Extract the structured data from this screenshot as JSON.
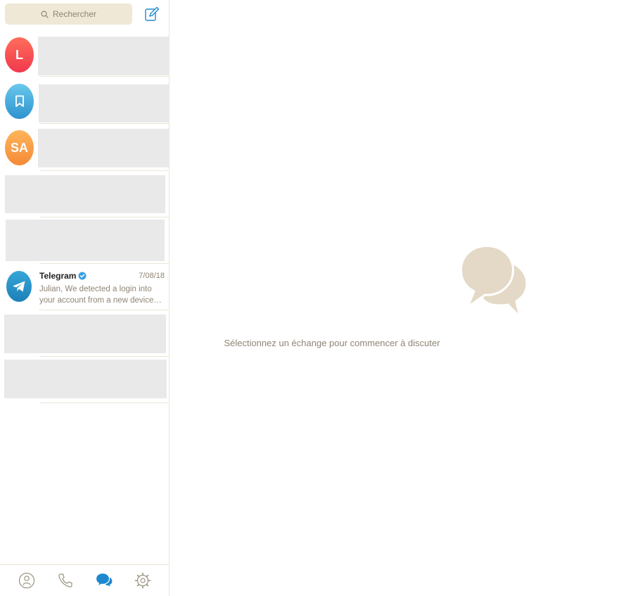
{
  "sidebar": {
    "search": {
      "placeholder": "Rechercher",
      "icon": "search-icon"
    },
    "compose": {
      "icon": "compose-icon"
    },
    "chats": [
      {
        "avatar_text": "L",
        "avatar_color": "#f5464f"
      },
      {
        "avatar_icon": "bookmark-icon",
        "avatar_color": "#3ba6dc"
      },
      {
        "avatar_text": "SA",
        "avatar_color": "#f99d44"
      },
      {},
      {},
      {
        "avatar_icon": "telegram-icon",
        "avatar_color": "#2a90c7",
        "name": "Telegram",
        "verified_icon": "verified-badge-icon",
        "date": "7/08/18",
        "preview": "Julian,  We detected a login into your account from a new device…"
      },
      {},
      {}
    ],
    "bottom_nav": [
      {
        "name": "contacts",
        "icon": "contacts-icon",
        "active": false
      },
      {
        "name": "calls",
        "icon": "phone-icon",
        "active": false
      },
      {
        "name": "chats",
        "icon": "chats-icon",
        "active": true
      },
      {
        "name": "settings",
        "icon": "settings-icon",
        "active": false
      }
    ]
  },
  "main": {
    "empty_icon": "chat-bubbles-icon",
    "empty_message": "Sélectionnez un échange pour commencer à discuter"
  },
  "colors": {
    "accent": "#1e88cf",
    "muted_text": "#8f8575",
    "search_bg": "#efe8d6",
    "placeholder_bg": "#e9e9e9",
    "empty_icon": "#e3d9c6"
  }
}
